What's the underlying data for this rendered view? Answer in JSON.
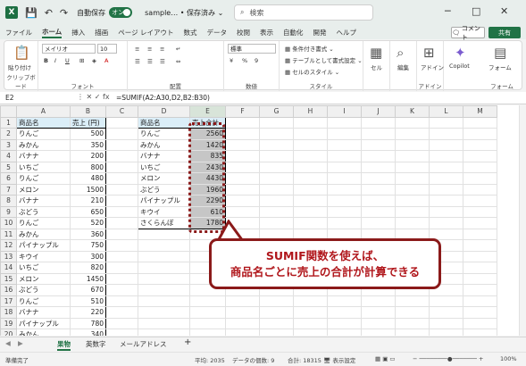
{
  "titlebar": {
    "autosave_label": "自動保存",
    "autosave_state": "オン",
    "doc_title": "sample… • 保存済み ⌄",
    "search_placeholder": "検索"
  },
  "tabs": [
    "ファイル",
    "ホーム",
    "挿入",
    "描画",
    "ページ レイアウト",
    "数式",
    "データ",
    "校閲",
    "表示",
    "自動化",
    "開発",
    "ヘルプ"
  ],
  "active_tab": "ホーム",
  "comment_label": "コメント",
  "share_label": "共有",
  "ribbon": {
    "paste_label": "貼り付け",
    "clipboard_label": "クリップボード",
    "font_name": "メイリオ",
    "font_size": "10",
    "font_label": "フォント",
    "align_label": "配置",
    "number_format": "標準",
    "number_label": "数値",
    "cond_format": "条件付き書式",
    "table_format": "テーブルとして書式設定",
    "cell_style": "セルのスタイル",
    "style_label": "スタイル",
    "cells_label": "セル",
    "edit_label": "編集",
    "addin_label": "アドイン",
    "addin_group_label": "アドイン",
    "copilot_label": "Copilot",
    "form_label": "フォーム",
    "form_group_label": "フォーム"
  },
  "formula_bar": {
    "name_box": "E2",
    "formula": "=SUMIF(A2:A30,D2,B2:B30)"
  },
  "columns": [
    "A",
    "B",
    "C",
    "D",
    "E",
    "F",
    "G",
    "H",
    "I",
    "J",
    "K",
    "L",
    "M"
  ],
  "rows": [
    {
      "n": "1",
      "a": "商品名",
      "b": "売上 (円)",
      "d": "商品名",
      "e": "売上合計"
    },
    {
      "n": "2",
      "a": "りんご",
      "b": "500",
      "d": "りんご",
      "e": "2560"
    },
    {
      "n": "3",
      "a": "みかん",
      "b": "350",
      "d": "みかん",
      "e": "1420"
    },
    {
      "n": "4",
      "a": "バナナ",
      "b": "200",
      "d": "バナナ",
      "e": "835"
    },
    {
      "n": "5",
      "a": "いちご",
      "b": "800",
      "d": "いちご",
      "e": "2430"
    },
    {
      "n": "6",
      "a": "りんご",
      "b": "480",
      "d": "メロン",
      "e": "4430"
    },
    {
      "n": "7",
      "a": "メロン",
      "b": "1500",
      "d": "ぶどう",
      "e": "1960"
    },
    {
      "n": "8",
      "a": "バナナ",
      "b": "210",
      "d": "パイナップル",
      "e": "2290"
    },
    {
      "n": "9",
      "a": "ぶどう",
      "b": "650",
      "d": "キウイ",
      "e": "610"
    },
    {
      "n": "10",
      "a": "りんご",
      "b": "520",
      "d": "さくらんぼ",
      "e": "1780"
    },
    {
      "n": "11",
      "a": "みかん",
      "b": "360",
      "d": "",
      "e": ""
    },
    {
      "n": "12",
      "a": "パイナップル",
      "b": "750",
      "d": "",
      "e": ""
    },
    {
      "n": "13",
      "a": "キウイ",
      "b": "300",
      "d": "",
      "e": ""
    },
    {
      "n": "14",
      "a": "いちご",
      "b": "820",
      "d": "",
      "e": ""
    },
    {
      "n": "15",
      "a": "メロン",
      "b": "1450",
      "d": "",
      "e": ""
    },
    {
      "n": "16",
      "a": "ぶどう",
      "b": "670",
      "d": "",
      "e": ""
    },
    {
      "n": "17",
      "a": "りんご",
      "b": "510",
      "d": "",
      "e": ""
    },
    {
      "n": "18",
      "a": "バナナ",
      "b": "220",
      "d": "",
      "e": ""
    },
    {
      "n": "19",
      "a": "パイナップル",
      "b": "780",
      "d": "",
      "e": ""
    },
    {
      "n": "20",
      "a": "みかん",
      "b": "340",
      "d": "",
      "e": ""
    }
  ],
  "callout": {
    "line1": "SUMIF関数を使えば、",
    "line2": "商品名ごとに売上の合計が計算できる"
  },
  "sheet_tabs": [
    "果物",
    "英数字",
    "メールアドレス"
  ],
  "active_sheet": "果物",
  "add_sheet": "+",
  "status": {
    "ready": "準備完了",
    "average": "平均: 2035",
    "count": "データの個数: 9",
    "sum": "合計: 18315",
    "display_settings": "表示設定",
    "zoom": "100%"
  }
}
